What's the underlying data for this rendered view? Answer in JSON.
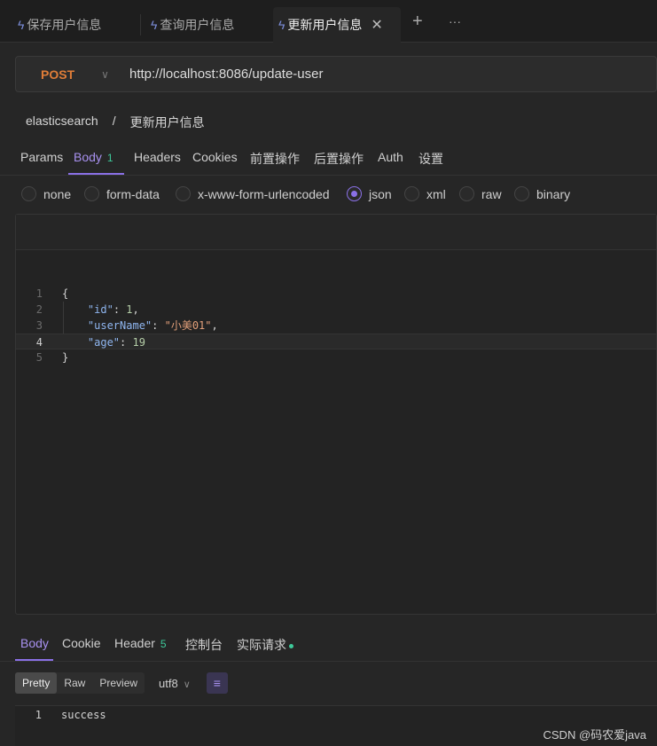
{
  "tabs": [
    {
      "label": "保存用户信息"
    },
    {
      "label": "查询用户信息"
    },
    {
      "label": "更新用户信息",
      "active": true
    }
  ],
  "toolbar": {
    "new_tab_icon": "+",
    "more_icon": "···"
  },
  "request": {
    "method": "POST",
    "url": "http://localhost:8086/update-user"
  },
  "breadcrumb": {
    "collection": "elasticsearch",
    "separator": "/",
    "name": "更新用户信息"
  },
  "request_tabs": {
    "params": "Params",
    "body": "Body",
    "body_count": "1",
    "headers": "Headers",
    "cookies": "Cookies",
    "pre": "前置操作",
    "post": "后置操作",
    "auth": "Auth",
    "settings": "设置"
  },
  "body_types": {
    "none": "none",
    "form_data": "form-data",
    "urlencoded": "x-www-form-urlencoded",
    "json": "json",
    "xml": "xml",
    "raw": "raw",
    "binary": "binary",
    "selected": "json"
  },
  "editor": {
    "line_numbers": [
      "1",
      "2",
      "3",
      "4",
      "5"
    ],
    "current_line": "4"
  },
  "response_tabs": {
    "body": "Body",
    "cookie": "Cookie",
    "header": "Header",
    "header_count": "5",
    "console": "控制台",
    "actual": "实际请求"
  },
  "response_view": {
    "pretty": "Pretty",
    "raw": "Raw",
    "preview": "Preview",
    "encoding": "utf8"
  },
  "response": {
    "line_number": "1",
    "text": "success"
  },
  "watermark": "CSDN @码农爱java",
  "colors": {
    "accent": "#8a70e6",
    "method": "#e07d38",
    "badge": "#3ec99a"
  }
}
